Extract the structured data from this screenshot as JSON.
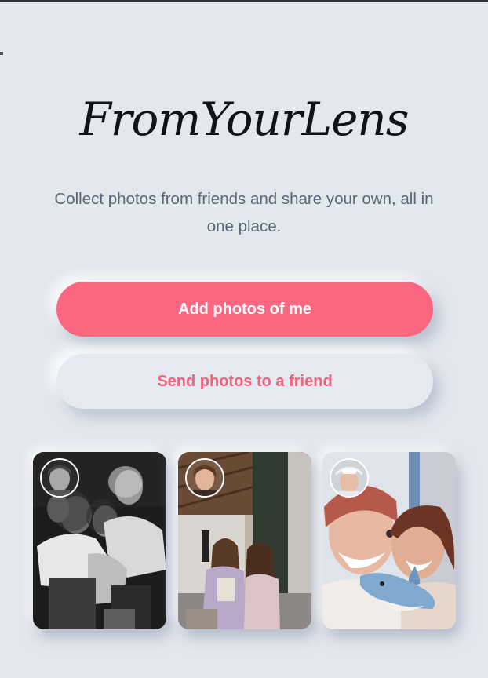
{
  "app": {
    "title": "FromYourLens",
    "subtitle": "Collect photos from friends and share your own, all in one place."
  },
  "actions": {
    "primary_label": "Add photos of me",
    "secondary_label": "Send photos to a friend"
  },
  "colors": {
    "background": "#e3e7ee",
    "accent": "#fb6680",
    "accent_text": "#f4617c",
    "title": "#111318",
    "subtitle": "#5b6676"
  },
  "gallery": {
    "cards": [
      {
        "name": "photo-card-group-bw",
        "avatar": "profile-avatar"
      },
      {
        "name": "photo-card-two-friends",
        "avatar": "profile-avatar"
      },
      {
        "name": "photo-card-selfie",
        "avatar": "profile-avatar"
      }
    ]
  }
}
